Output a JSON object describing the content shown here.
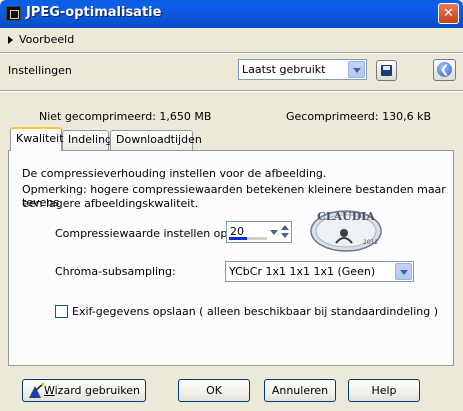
{
  "window": {
    "title": "JPEG-optimalisatie",
    "close_glyph": "✕"
  },
  "preview": {
    "label": "Voorbeeld"
  },
  "settings": {
    "label": "Instellingen",
    "preset_selected": "Laatst gebruikt",
    "save_icon": "save-disk-icon",
    "back_icon": "back-arrow-icon",
    "back_glyph": "❮"
  },
  "sizes": {
    "uncompressed": "Niet gecomprimeerd: 1,650 MB",
    "compressed": "Gecomprimeerd: 130,6 kB"
  },
  "tabs": [
    {
      "label": "Kwaliteit",
      "active": true
    },
    {
      "label": "Indeling",
      "active": false
    },
    {
      "label": "Downloadtijden",
      "active": false
    }
  ],
  "quality": {
    "intro": "De compressieverhouding instellen voor de afbeelding.",
    "note_line1": "Opmerking:  hogere compressiewaarden betekenen kleinere bestanden maar tevens",
    "note_line2": "een lagere afbeeldingskwaliteit.",
    "compression_label": "Compressiewaarde instellen op:",
    "compression_value": "20",
    "compression_level": 0.2,
    "chroma_label": "Chroma-subsampling:",
    "chroma_selected": "YCbCr  1x1  1x1  1x1  (Geen)",
    "exif_label": "Exif-gegevens opslaan ( alleen beschikbaar bij standaardindeling )",
    "exif_checked": false
  },
  "watermark": {
    "text": "CLAUDIA",
    "year": "2012"
  },
  "buttons": {
    "wizard_u": "W",
    "wizard_rest": "izard gebruiken",
    "ok": "OK",
    "cancel": "Annuleren",
    "help": "Help"
  },
  "colors": {
    "title_bar": "#0a5fda",
    "accent_tab": "#ffc83c",
    "dialog_bg": "#ece9d8"
  }
}
